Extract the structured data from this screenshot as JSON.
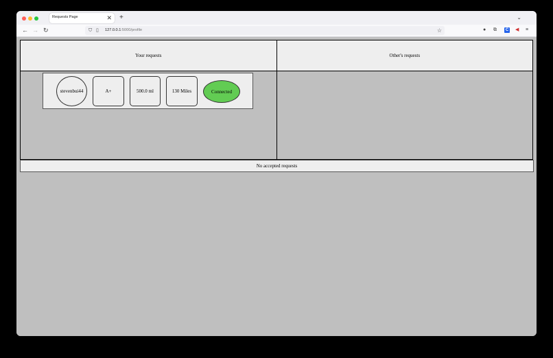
{
  "browser": {
    "tab_title": "Requests Page",
    "tab_close": "✕",
    "new_tab": "+",
    "list_tabs": "⌄",
    "url_host": "127.0.0.1",
    "url_path": ":5000/profile",
    "icons": [
      "back-icon",
      "forward-icon",
      "reload-icon",
      "shield-icon",
      "page-icon",
      "bookmark-star-icon",
      "extension-icon",
      "puzzle-icon",
      "megaphone-icon",
      "menu-icon"
    ]
  },
  "page": {
    "columns": {
      "yours": "Your requests",
      "others": "Other's requests"
    },
    "your_requests": [
      {
        "username": "stevenbui44",
        "blood_type": "A+",
        "amount": "500.0 ml",
        "distance": "130 Miles",
        "status": "Connected"
      }
    ],
    "accepted_text": "No accepted requests"
  },
  "colors": {
    "page_background": "#bfbfbf",
    "header_background": "#eeeeee",
    "status_connected": "#62cc53"
  }
}
